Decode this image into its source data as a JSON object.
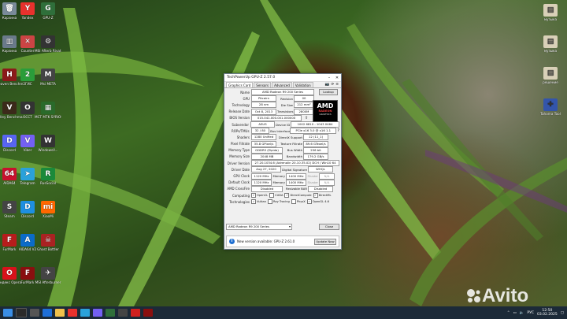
{
  "desktop": {
    "icons": [
      {
        "label": "Корзина",
        "color": "#7a8a9a",
        "glyph": "🗑"
      },
      {
        "label": "Yandex",
        "color": "#e8312d",
        "glyph": "Y"
      },
      {
        "label": "GPU-Z",
        "color": "#2f6f3a",
        "glyph": "G"
      },
      {
        "label": "Корзина",
        "color": "#6a7a8a",
        "glyph": "▥"
      },
      {
        "label": "Counter",
        "color": "#c44",
        "glyph": "✕"
      },
      {
        "label": "MSI Afterb Rivatuner",
        "color": "#333",
        "glyph": "⚙"
      },
      {
        "label": "Heaven Benchma...",
        "color": "#8b1a1a",
        "glyph": "H"
      },
      {
        "label": "2ГИС",
        "color": "#2a9d3a",
        "glyph": "2"
      },
      {
        "label": "Msi META",
        "color": "#444",
        "glyph": "M"
      },
      {
        "label": "Valley Benchma...",
        "color": "#3b2a1a",
        "glyph": "V"
      },
      {
        "label": "OCCT",
        "color": "#333",
        "glyph": "O"
      },
      {
        "label": "MCT MTK SYRIOS",
        "color": "#2a6a2a",
        "glyph": "▦"
      },
      {
        "label": "Discord",
        "color": "#5865f2",
        "glyph": "D"
      },
      {
        "label": "Viber",
        "color": "#7360f2",
        "glyph": "V"
      },
      {
        "label": "WindowsV...",
        "color": "#333",
        "glyph": "W"
      },
      {
        "label": "AIDA64",
        "color": "#c8102e",
        "glyph": "64"
      },
      {
        "label": "Telegram",
        "color": "#2aa1da",
        "glyph": "➤"
      },
      {
        "label": "RusSocial",
        "color": "#1a8a3a",
        "glyph": "R"
      },
      {
        "label": "Steam",
        "color": "#444",
        "glyph": "S"
      },
      {
        "label": "Discord",
        "color": "#1e8fe1",
        "glyph": "D"
      },
      {
        "label": "XiaoMi",
        "color": "#ff6700",
        "glyph": "mi"
      },
      {
        "label": "FurMark",
        "color": "#b71c1c",
        "glyph": "F"
      },
      {
        "label": "AIDA64 V2",
        "color": "#0b6bc8",
        "glyph": "A"
      },
      {
        "label": "Ghost Bottler",
        "color": "#a22",
        "glyph": "☠"
      },
      {
        "label": "Яндекс Opera",
        "color": "#d8111b",
        "glyph": "O"
      },
      {
        "label": "FurMark",
        "color": "#8a0f0f",
        "glyph": "F"
      },
      {
        "label": "MSI Afterburner",
        "color": "#444",
        "glyph": "✈"
      }
    ],
    "right_icons": [
      {
        "label": "музыка",
        "color": "#d9d0b8",
        "glyph": "▤"
      },
      {
        "label": "музыка",
        "color": "#d9d0b8",
        "glyph": "▤"
      },
      {
        "label": "решение",
        "color": "#d9d0b8",
        "glyph": "▤"
      },
      {
        "label": "Tahoma Tool",
        "color": "#3355aa",
        "glyph": "✚"
      }
    ]
  },
  "window": {
    "title": "TechPowerUp GPU-Z 2.57.0",
    "tabs": [
      "Graphics Card",
      "Sensors",
      "Advanced",
      "Validation"
    ],
    "rows": {
      "name_label": "Name",
      "name_value": "AMD Radeon R9 200 Series",
      "lookup": "Lookup",
      "gpu_label": "GPU",
      "gpu_value": "Pitcairn",
      "revision_label": "Revision",
      "revision_value": "00",
      "tech_label": "Technology",
      "tech_value": "28 nm",
      "die_label": "Die Size",
      "die_value": "212 mm²",
      "release_label": "Release Date",
      "release_value": "Oct 8, 2013",
      "trans_label": "Transistors",
      "trans_value": "2800M",
      "bios_label": "BIOS Version",
      "bios_value": "015.041.000.001.000000",
      "uefi": "UEFI",
      "subvendor_label": "Subvendor",
      "subvendor_value": "ASUS",
      "device_label": "Device ID",
      "device_value": "1002 6810 - 1043 0464",
      "rops_label": "ROPs/TMUs",
      "rops_value": "32 / 80",
      "bus_label": "Bus Interface",
      "bus_value": "PCIe x16 3.0 @ x16 1.1",
      "shaders_label": "Shaders",
      "shaders_value": "1280 Unified",
      "dx_label": "DirectX Support",
      "dx_value": "12 (11_1)",
      "pixel_label": "Pixel Fillrate",
      "pixel_value": "35.8 GPixel/s",
      "tex_label": "Texture Fillrate",
      "tex_value": "89.6 GTexel/s",
      "memtype_label": "Memory Type",
      "memtype_value": "GDDR5 (Elpida)",
      "buswidth_label": "Bus Width",
      "buswidth_value": "256 bit",
      "memsize_label": "Memory Size",
      "memsize_value": "2048 MB",
      "bandwidth_label": "Bandwidth",
      "bandwidth_value": "179.2 GB/s",
      "driverver_label": "Driver Version",
      "driverver_value": "27.20.1034.6 (Adrenalin 20.10.35.02) DCH / Win10 64",
      "driverdate_label": "Driver Date",
      "driverdate_value": "Aug 27, 2020",
      "sig_label": "Digital Signature",
      "sig_value": "WHQL",
      "gpuclock_label": "GPU Clock",
      "gpuclock_value": "1120 MHz",
      "memory_label": "Memory",
      "gpuclock_mem": "1400 MHz",
      "shader_label": "Shader",
      "shader_na": "N/A",
      "defclock_label": "Default Clock",
      "defclock_value": "1120 MHz",
      "defclock_mem": "1400 MHz",
      "shader2_na": "N/A",
      "crossfire_label": "AMD CrossFire",
      "crossfire_value": "Disabled",
      "rebar_label": "Resizable BAR",
      "rebar_value": "Disabled",
      "computing_label": "Computing",
      "tech2_label": "Technologies"
    },
    "computing": [
      "OpenCL",
      "CUDA",
      "DirectCompute",
      "DirectML"
    ],
    "technologies": [
      "Vulkan",
      "Ray Tracing",
      "PhysX",
      "OpenGL 4.6"
    ],
    "selected_card": "AMD Radeon R9 200 Series",
    "close": "Close",
    "notice": "New version available: GPU-Z 2.61.0",
    "update_now": "Update Now"
  },
  "taskbar": {
    "lang": "РУС",
    "time": "12:50",
    "date": "03.02.2025"
  },
  "watermark": "Avito"
}
